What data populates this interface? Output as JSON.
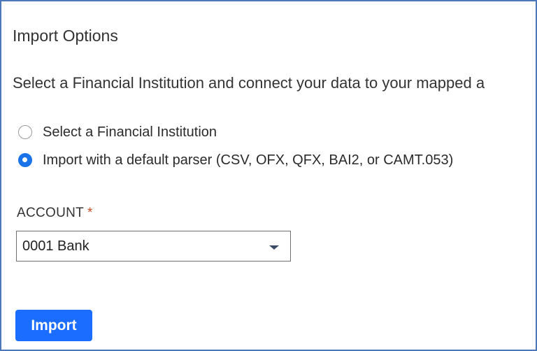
{
  "section": {
    "title": "Import Options",
    "description": "Select a Financial Institution and connect your data to your mapped a"
  },
  "import_method": {
    "options": [
      {
        "label": "Select a Financial Institution",
        "selected": false
      },
      {
        "label": "Import with a default parser (CSV, OFX, QFX, BAI2, or CAMT.053)",
        "selected": true
      }
    ]
  },
  "account": {
    "label": "ACCOUNT",
    "required_mark": "*",
    "selected_value": "0001 Bank"
  },
  "actions": {
    "import_label": "Import"
  },
  "colors": {
    "accent": "#1a6dff",
    "frame_border": "#4a78b8",
    "required": "#c0502a"
  },
  "icons": {
    "dropdown": "caret-down-icon"
  }
}
